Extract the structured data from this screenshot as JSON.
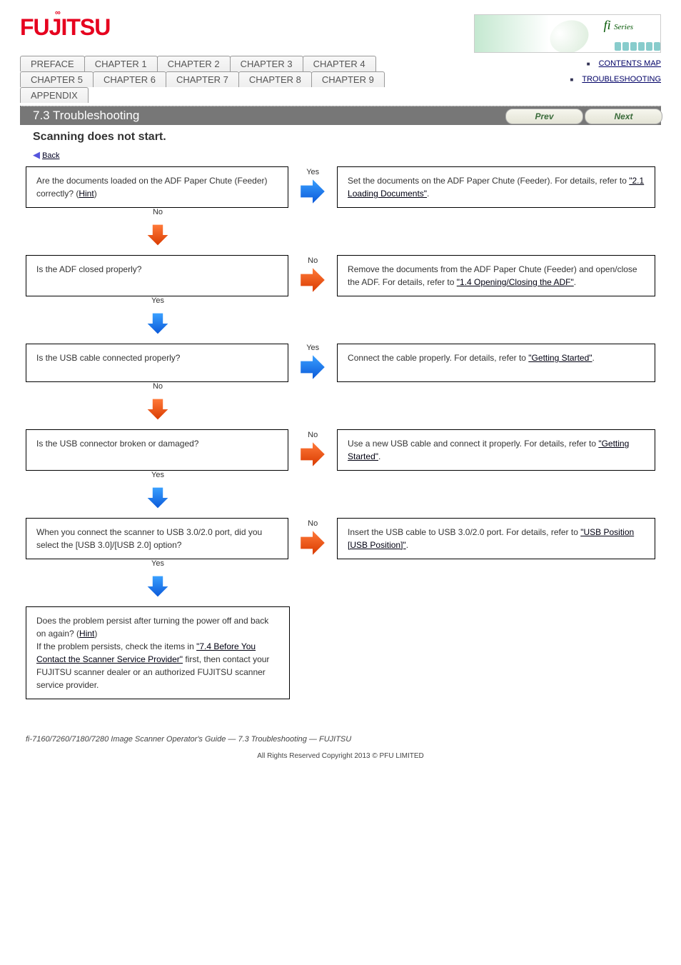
{
  "logo_text": "FUJITSU",
  "brand_fi": "fi",
  "brand_series": "Series",
  "tabs_row1": [
    "PREFACE",
    "CHAPTER 1",
    "CHAPTER 2",
    "CHAPTER 3",
    "CHAPTER 4"
  ],
  "tabs_row2": [
    "CHAPTER 5",
    "CHAPTER 6",
    "CHAPTER 7",
    "CHAPTER 8",
    "CHAPTER 9"
  ],
  "tabs_row3": [
    "APPENDIX"
  ],
  "sidelinks": [
    "CONTENTS MAP",
    "TROUBLESHOOTING"
  ],
  "bar_title": "7.3 Troubleshooting",
  "prev": "Prev",
  "next": "Next",
  "section_title": "Scanning does not start.",
  "back_label": "Back",
  "yes": "Yes",
  "no": "No",
  "steps": [
    {
      "q_pre": "Are the documents loaded on the ADF Paper Chute (Feeder) correctly?",
      "q_link_start": "(",
      "q_link": "Hint",
      "q_link_end": ")",
      "left_arrow": "orange",
      "right_arrow": "blue",
      "r_text": "Set the documents on the ADF Paper Chute (Feeder). For details, refer to ",
      "r_link": "\"2.1 Loading Documents\"",
      "r_end": "."
    },
    {
      "q_pre": "Is the ADF closed properly?",
      "left_arrow": "blue",
      "right_arrow": "orange",
      "r_text": "Remove the documents from the ADF Paper Chute (Feeder) and open/close the ADF. For details, refer to ",
      "r_link": "\"1.4 Opening/Closing the ADF\"",
      "r_end": "."
    },
    {
      "q_pre": "Is the USB cable connected properly?",
      "left_arrow": "orange",
      "right_arrow": "blue",
      "r_text": "Connect the cable properly. For details, refer to ",
      "r_link": "\"Getting Started\"",
      "r_end": "."
    },
    {
      "q_pre": "Is the USB connector broken or damaged?",
      "left_arrow": "blue",
      "right_arrow": "orange",
      "r_text": "Use a new USB cable and connect it properly. For details, refer to ",
      "r_link": "\"Getting Started\"",
      "r_end": "."
    },
    {
      "q_pre": "When you connect the scanner to USB 3.0/2.0 port, did you select the [USB 3.0]/[USB 2.0] option?",
      "left_arrow": "blue",
      "right_arrow": "orange",
      "r_text": "Insert the USB cable to USB 3.0/2.0 port. For details, refer to ",
      "r_link": "\"USB Position [USB Position]\"",
      "r_end": "."
    }
  ],
  "final_pre": "Does the problem persist after turning the power off and back on again?",
  "final_link_start": " (",
  "final_link": "Hint",
  "final_link_end": ")",
  "final_body": "If the problem persists, check the items in ",
  "final_body_link": "\"7.4 Before You Contact the Scanner Service Provider\"",
  "final_body_mid": " first, then contact your FUJITSU scanner dealer or an authorized FUJITSU scanner service provider.",
  "cite": "fi-7160/7260/7180/7280 Image Scanner Operator's Guide — 7.3 Troubleshooting — FUJITSU",
  "copyright": "All Rights Reserved Copyright 2013 © PFU LIMITED"
}
